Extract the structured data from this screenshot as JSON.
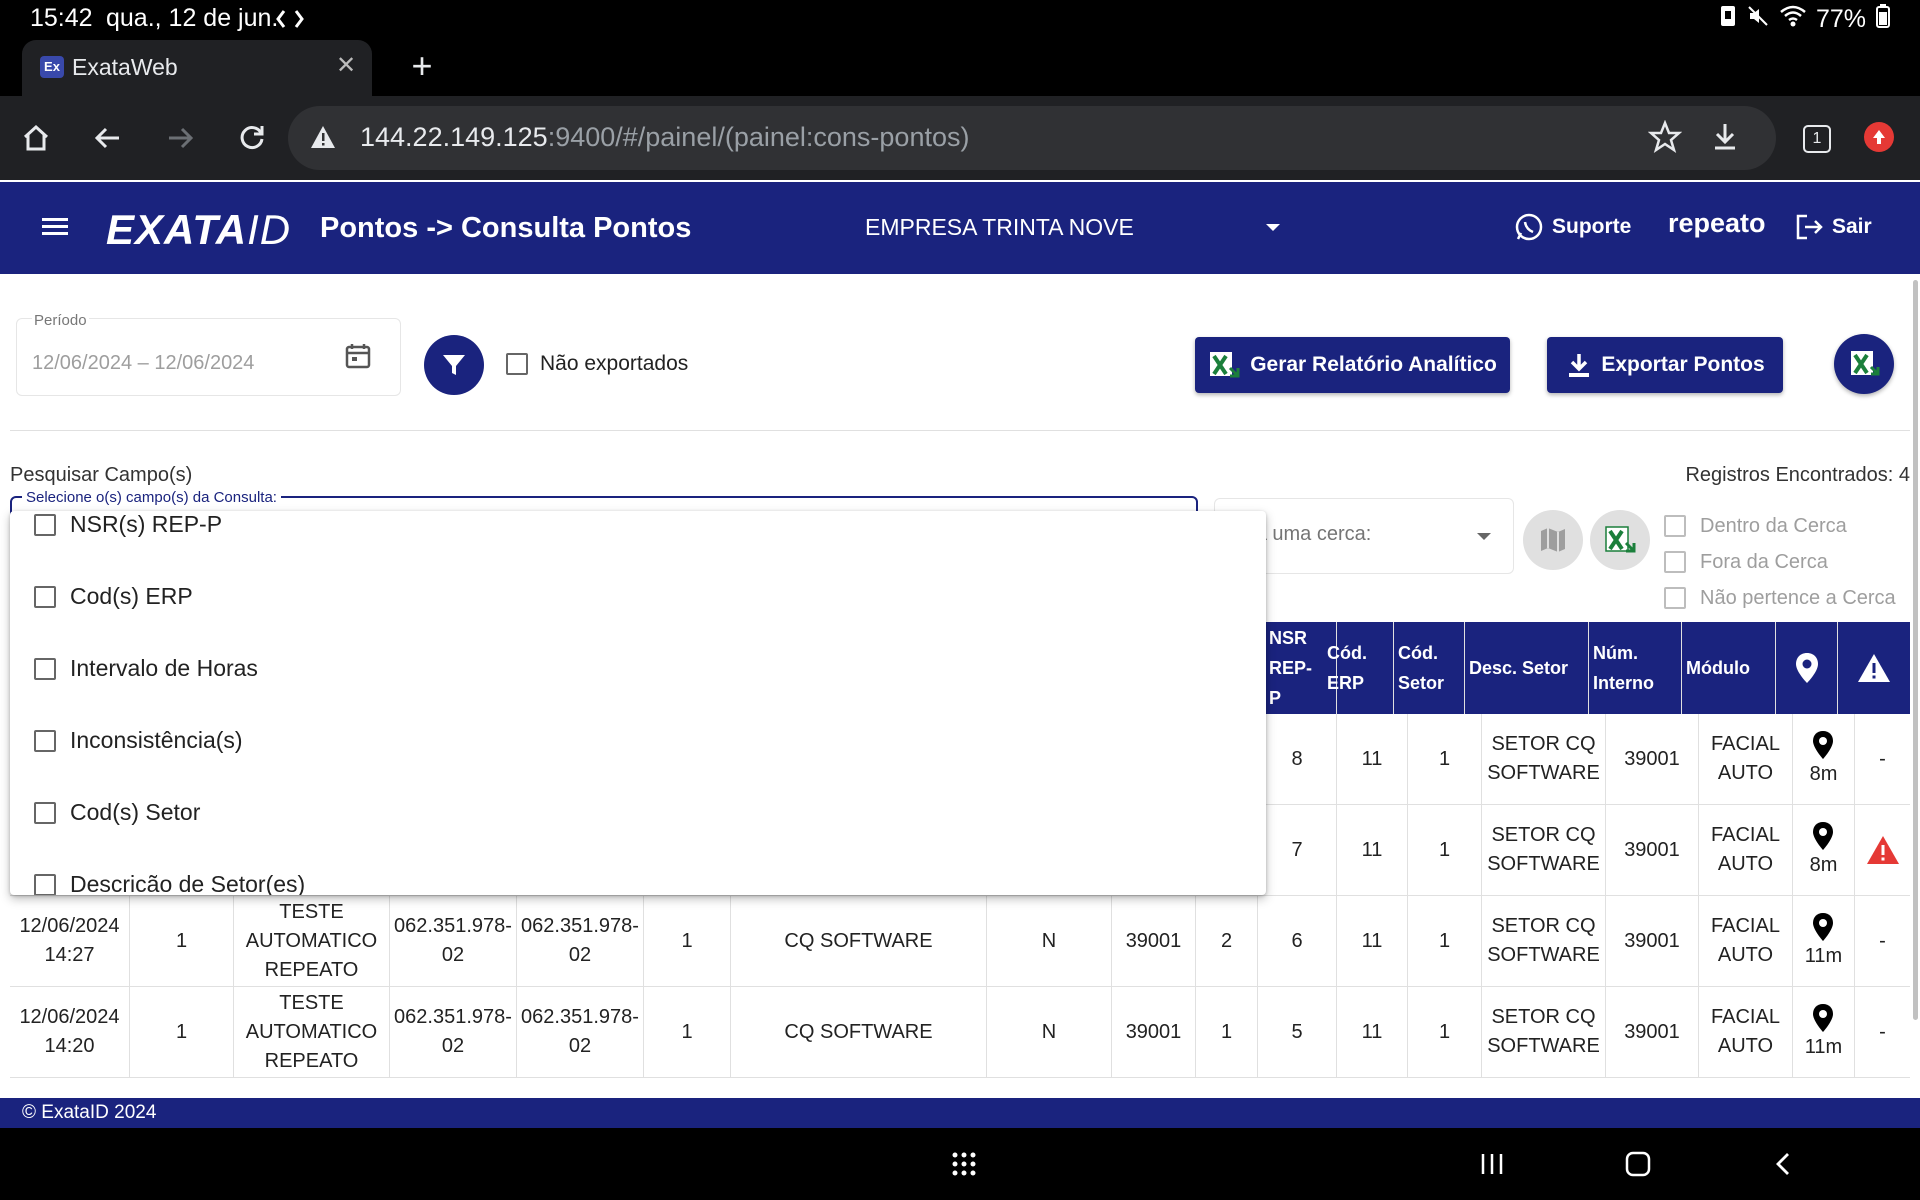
{
  "statusbar": {
    "time": "15:42",
    "date": "qua., 12 de jun.",
    "battery": "77%"
  },
  "browser": {
    "tab_title": "ExataWeb",
    "favicon_text": "Ex",
    "url_host": "144.22.149.125",
    "url_path": ":9400/#/painel/(painel:cons-pontos)",
    "tab_count": "1"
  },
  "appbar": {
    "logo_main": "EXATA",
    "logo_id": "ID",
    "page_title": "Pontos -> Consulta Pontos",
    "company": "EMPRESA TRINTA NOVE",
    "support": "Suporte",
    "user": "repeato",
    "logout": "Sair"
  },
  "filters": {
    "period_label": "Período",
    "period_value": "12/06/2024 – 12/06/2024",
    "not_exported": "Não exportados",
    "analytic_report": "Gerar Relatório Analítico",
    "export_points": "Exportar Pontos"
  },
  "search": {
    "label": "Pesquisar Campo(s)",
    "field_label": "Selecione o(s) campo(s) da Consulta:",
    "records": "Registros Encontrados: 4",
    "fence_placeholder": "olha uma cerca:",
    "fence_options": [
      "Dentro da Cerca",
      "Fora da Cerca",
      "Não pertence a Cerca"
    ]
  },
  "dropdown": {
    "options": [
      "NSR(s) REP-P",
      "Cod(s) ERP",
      "Intervalo de Horas",
      "Inconsistência(s)",
      "Cod(s) Setor",
      "Descricão de Setor(es)"
    ]
  },
  "table": {
    "headers": {
      "nsr": "NSR\nREP-\nP",
      "cod_erp": "Cód.\nERP",
      "cod_setor": "Cód.\nSetor",
      "desc_setor": "Desc. Setor",
      "num_interno": "Núm.\nInterno",
      "modulo": "Módulo"
    },
    "rows": [
      {
        "date": "",
        "a": "",
        "name": "",
        "cpf1": "",
        "cpf2": "",
        "b": "",
        "setor": "",
        "n": "",
        "int": "",
        "c": "",
        "nsr": "8",
        "erp": "11",
        "cs": "1",
        "desc": "SETOR CQ\nSOFTWARE",
        "num": "39001",
        "mod": "FACIAL\nAUTO",
        "dist": "8m",
        "warn": "-"
      },
      {
        "date": "",
        "a": "",
        "name": "",
        "cpf1": "",
        "cpf2": "",
        "b": "",
        "setor": "",
        "n": "",
        "int": "",
        "c": "",
        "nsr": "7",
        "erp": "11",
        "cs": "1",
        "desc": "SETOR CQ\nSOFTWARE",
        "num": "39001",
        "mod": "FACIAL\nAUTO",
        "dist": "8m",
        "warn": ""
      },
      {
        "date": "12/06/2024\n14:27",
        "a": "1",
        "name": "TESTE\nAUTOMATICO\nREPEATO",
        "cpf1": "062.351.978-\n02",
        "cpf2": "062.351.978-\n02",
        "b": "1",
        "setor": "CQ SOFTWARE",
        "n": "N",
        "int": "39001",
        "c": "2",
        "nsr": "6",
        "erp": "11",
        "cs": "1",
        "desc": "SETOR CQ\nSOFTWARE",
        "num": "39001",
        "mod": "FACIAL\nAUTO",
        "dist": "11m",
        "warn": "-"
      },
      {
        "date": "12/06/2024\n14:20",
        "a": "1",
        "name": "TESTE\nAUTOMATICO\nREPEATO",
        "cpf1": "062.351.978-\n02",
        "cpf2": "062.351.978-\n02",
        "b": "1",
        "setor": "CQ SOFTWARE",
        "n": "N",
        "int": "39001",
        "c": "1",
        "nsr": "5",
        "erp": "11",
        "cs": "1",
        "desc": "SETOR CQ\nSOFTWARE",
        "num": "39001",
        "mod": "FACIAL\nAUTO",
        "dist": "11m",
        "warn": "-"
      }
    ]
  },
  "footer": {
    "copyright": "© ExataID 2024"
  },
  "colors": {
    "primary": "#1a237e",
    "alert": "#e53935"
  }
}
